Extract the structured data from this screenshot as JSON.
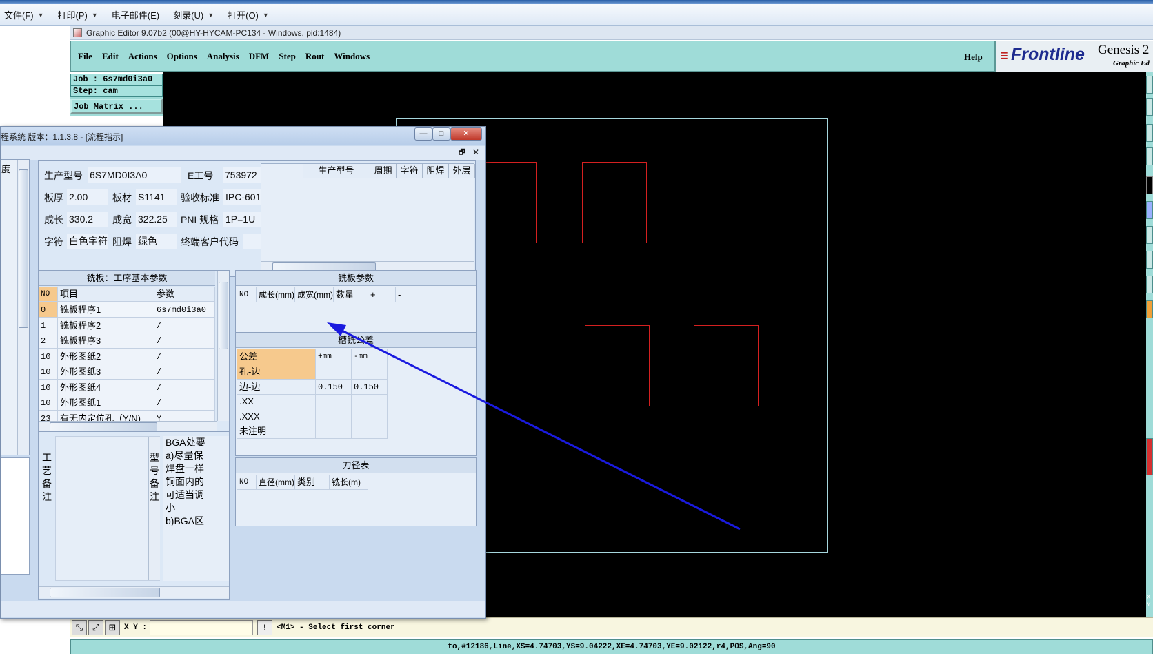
{
  "explorer": {
    "menu": [
      {
        "label": "文件(F)"
      },
      {
        "label": "打印(P)"
      },
      {
        "label": "电子邮件(E)"
      },
      {
        "label": "刻录(U)"
      },
      {
        "label": "打开(O)"
      }
    ]
  },
  "genesis": {
    "title": "Graphic Editor 9.07b2 (00@HY-HYCAM-PC134 - Windows, pid:1484)",
    "menu": [
      "File",
      "Edit",
      "Actions",
      "Options",
      "Analysis",
      "DFM",
      "Step",
      "Rout",
      "Windows"
    ],
    "help": "Help",
    "brand": {
      "logo": "Frontline",
      "product": "Genesis 2",
      "subtitle": "Graphic Ed"
    },
    "job": "Job : 6s7md0i3a0",
    "step": "Step: cam",
    "job_matrix": "Job Matrix ...",
    "xy_label": "X Y :",
    "xy_value": "",
    "status_message": "<M1> - Select first corner",
    "coords": "to,#12186,Line,XS=4.74703,YS=9.04222,XE=4.74703,YE=9.02122,r4,POS,Ang=90",
    "right_strip_text": "X Y",
    "colors": {
      "teal": "#9fdcd8",
      "canvas": "#000000",
      "pad_outline": "#d42020",
      "board_outline": "#a6d6dd",
      "arrow": "#1a1adf"
    }
  },
  "app": {
    "title": "程系统   版本：1.1.3.8 - [流程指示]",
    "window_buttons": {
      "minimize": "—",
      "maximize": "□",
      "close": "✕"
    },
    "inner_buttons": {
      "minimize": "_",
      "restore": "🗗",
      "close": "✕"
    },
    "left_col_header": "度",
    "info": {
      "prod_model_label": "生产型号",
      "prod_model": "6S7MD0I3A0",
      "e_no_label": "E工号",
      "e_no": "753972",
      "thickness_label": "板厚",
      "thickness": "2.00",
      "material_label": "板材",
      "material": "S1141",
      "standard_label": "验收标准",
      "standard": "IPC-601",
      "length_label": "成长",
      "length": "330.2",
      "width_label": "成宽",
      "width": "322.25",
      "pnl_label": "PNL规格",
      "pnl": "1P=1U",
      "char_label": "字符",
      "char": "白色字符",
      "mask_label": "阻焊",
      "mask": "绿色",
      "customer_label": "终端客户代码",
      "customer": ""
    },
    "history_headers": [
      "生产型号",
      "周期",
      "字符",
      "阻焊",
      "外层"
    ],
    "basic_params": {
      "title": "铣板：工序基本参数",
      "headers": [
        "NO",
        "项目",
        "参数"
      ],
      "rows": [
        {
          "no": "0",
          "item": "铣板程序1",
          "param": "6s7md0i3a0"
        },
        {
          "no": "1",
          "item": "铣板程序2",
          "param": "/"
        },
        {
          "no": "2",
          "item": "铣板程序3",
          "param": "/"
        },
        {
          "no": "10",
          "item": "外形图纸2",
          "param": "/"
        },
        {
          "no": "10",
          "item": "外形图纸3",
          "param": "/"
        },
        {
          "no": "10",
          "item": "外形图纸4",
          "param": "/"
        },
        {
          "no": "10",
          "item": "外形图纸1",
          "param": "/"
        },
        {
          "no": "23",
          "item": "有无内定位孔（Y/N)",
          "param": "Y"
        }
      ]
    },
    "mill_params": {
      "title": "铣板参数",
      "headers": [
        "NO",
        "成长(mm)",
        "成宽(mm)",
        "数量",
        "+",
        "-"
      ]
    },
    "tolerance": {
      "title": "槽铣公差",
      "headers": [
        "公差",
        "+mm",
        "-mm"
      ],
      "rows": [
        {
          "name": "孔-边",
          "plus": "",
          "minus": ""
        },
        {
          "name": "边-边",
          "plus": "0.150",
          "minus": "0.150"
        },
        {
          "name": ".XX",
          "plus": "",
          "minus": ""
        },
        {
          "name": ".XXX",
          "plus": "",
          "minus": ""
        },
        {
          "name": "未注明",
          "plus": "",
          "minus": ""
        }
      ]
    },
    "tools": {
      "title": "刀径表",
      "headers": [
        "NO",
        "直径(mm)",
        "类别",
        "铣长(m)"
      ]
    },
    "process_note_label": "工艺备注",
    "model_note_label": "型号备注",
    "model_note_lines": [
      "BGA处要",
      "a)尽量保",
      "焊盘一样",
      "铜面内的",
      "可适当调",
      "小",
      "b)BGA区"
    ]
  }
}
